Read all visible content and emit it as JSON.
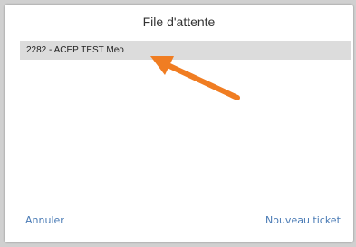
{
  "dialog": {
    "title": "File d'attente"
  },
  "queue": {
    "items": [
      {
        "label": "2282 - ACEP TEST Meo"
      }
    ]
  },
  "actions": {
    "cancel_label": "Annuler",
    "new_ticket_label": "Nouveau ticket"
  },
  "colors": {
    "link": "#4a7bb5",
    "arrow": "#f07d22",
    "selected_row": "#dcdcdc"
  }
}
